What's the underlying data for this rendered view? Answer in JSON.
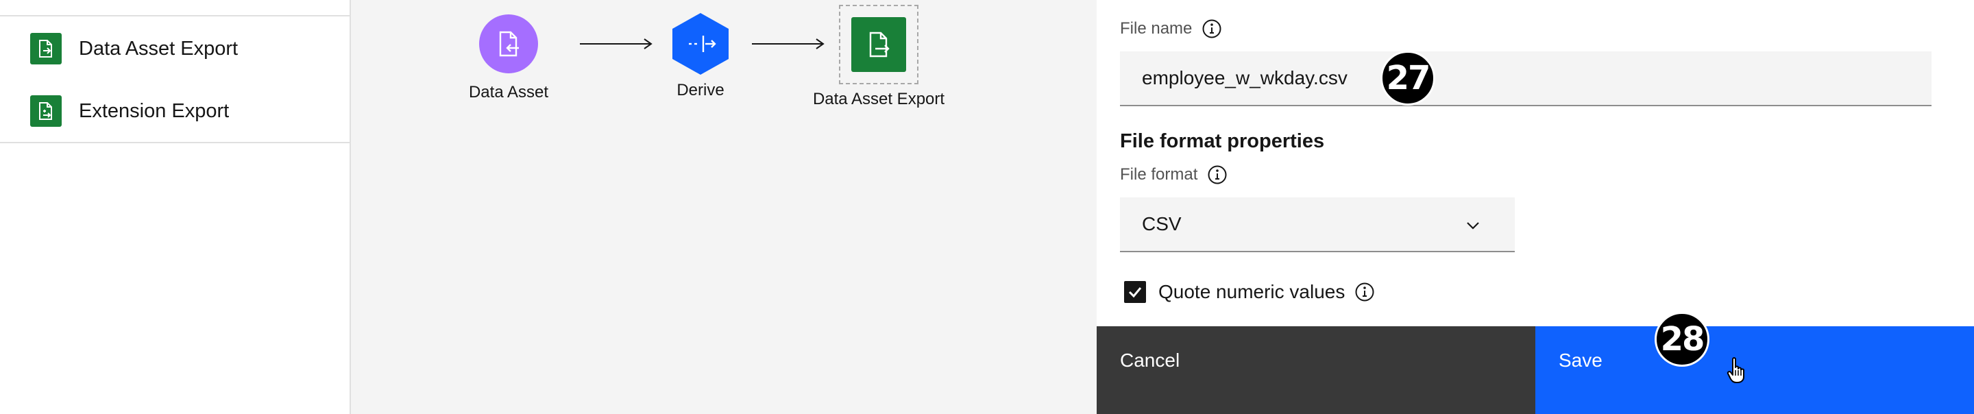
{
  "palette": {
    "items": [
      {
        "label": "Data Asset Export",
        "icon": "document-export-icon"
      },
      {
        "label": "Extension Export",
        "icon": "extension-export-icon"
      }
    ]
  },
  "canvas": {
    "nodes": [
      {
        "label": "Data Asset",
        "icon": "data-asset-import-icon",
        "color": "#a56eff"
      },
      {
        "label": "Derive",
        "icon": "derive-icon",
        "color": "#0f62fe"
      },
      {
        "label": "Data Asset Export",
        "icon": "document-export-icon",
        "color": "#198038"
      }
    ]
  },
  "properties": {
    "file_name_label": "File name",
    "file_name_value": "employee_w_wkday.csv",
    "section_title": "File format properties",
    "file_format_label": "File format",
    "file_format_value": "CSV",
    "quote_numeric_label": "Quote numeric values",
    "quote_numeric_checked": true
  },
  "footer": {
    "cancel_label": "Cancel",
    "save_label": "Save"
  },
  "badges": {
    "step_27": "27",
    "step_28": "28"
  },
  "colors": {
    "save_blue": "#0f62fe",
    "cancel_gray": "#393939",
    "export_green": "#198038",
    "asset_purple": "#a56eff"
  }
}
